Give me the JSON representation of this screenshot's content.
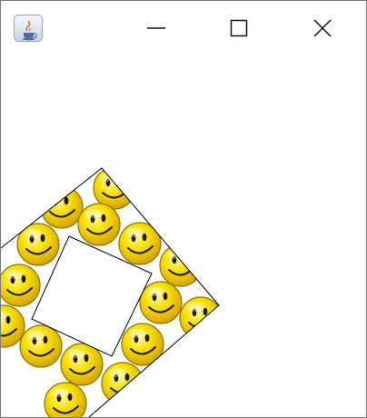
{
  "window": {
    "app_icon": "java-coffee-cup-icon",
    "controls": {
      "minimize": "minimize-icon",
      "maximize": "maximize-icon",
      "close": "close-icon"
    }
  },
  "canvas": {
    "tile_icon": "smiley-face-icon",
    "colors": {
      "smiley_fill": "#f3d400",
      "smiley_outline": "#8a7400",
      "frame_stroke": "#000000",
      "background": "#ffffff"
    }
  }
}
